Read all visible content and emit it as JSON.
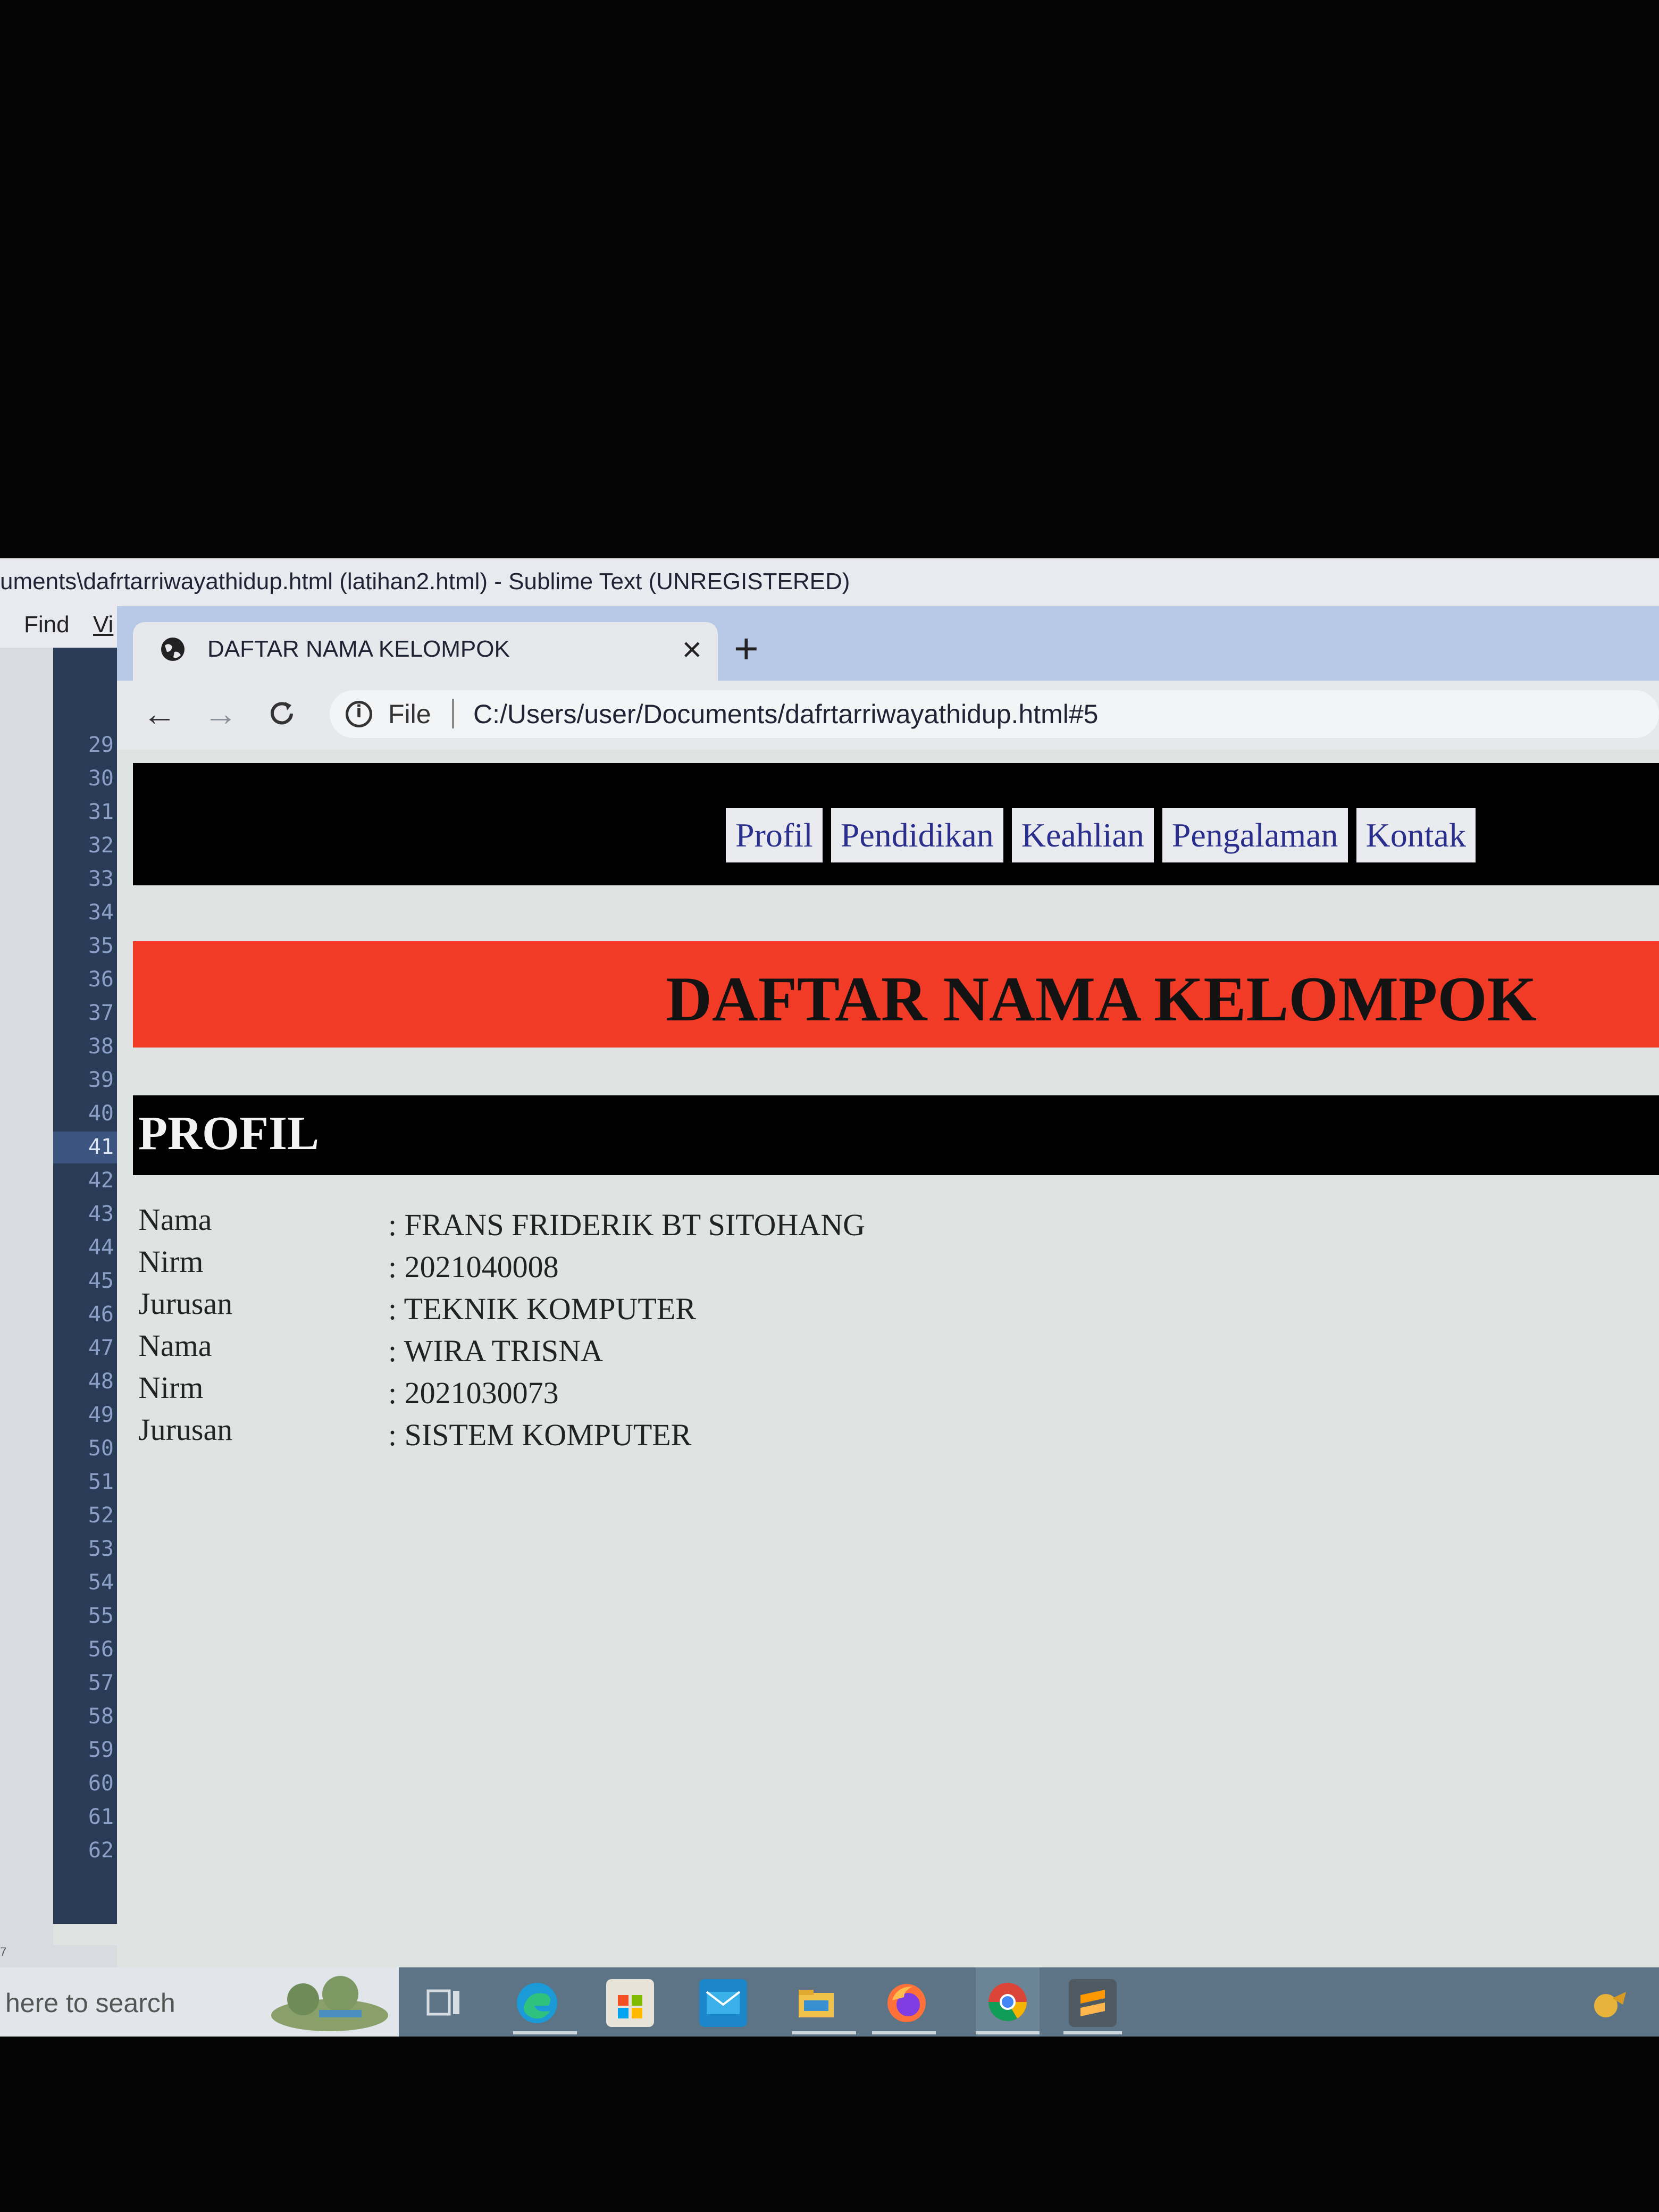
{
  "sublime": {
    "title": "uments\\dafrtarriwayathidup.html (latihan2.html) - Sublime Text (UNREGISTERED)",
    "menu": [
      "Find",
      "Vi"
    ],
    "line_numbers": [
      "29",
      "30",
      "31",
      "32",
      "33",
      "34",
      "35",
      "36",
      "37",
      "38",
      "39",
      "40",
      "41",
      "42",
      "43",
      "44",
      "45",
      "46",
      "47",
      "48",
      "49",
      "50",
      "51",
      "52",
      "53",
      "54",
      "55",
      "56",
      "57",
      "58",
      "59",
      "60",
      "61",
      "62"
    ],
    "active_line": "41",
    "status_fragment": "7"
  },
  "browser": {
    "tab_title": "DAFTAR NAMA KELOMPOK",
    "tab_close": "×",
    "new_tab": "+",
    "nav": {
      "back": "←",
      "forward": "→",
      "reload": "C"
    },
    "file_label": "File",
    "url": "C:/Users/user/Documents/dafrtarriwayathidup.html#5"
  },
  "page": {
    "nav_links": [
      "Profil",
      "Pendidikan",
      "Keahlian",
      "Pengalaman",
      "Kontak"
    ],
    "banner_title": "DAFTAR NAMA KELOMPOK",
    "section_title": "PROFIL",
    "profile_rows": [
      {
        "label": "Nama",
        "value": ": FRANS FRIDERIK BT SITOHANG"
      },
      {
        "label": "Nirm",
        "value": ": 2021040008"
      },
      {
        "label": "Jurusan",
        "value": ": TEKNIK KOMPUTER"
      },
      {
        "label": "Nama",
        "value": ": WIRA TRISNA"
      },
      {
        "label": "Nirm",
        "value": ": 2021030073"
      },
      {
        "label": "Jurusan",
        "value": ": SISTEM KOMPUTER"
      }
    ]
  },
  "taskbar": {
    "search_placeholder": "here to search",
    "icons": [
      "task-view-icon",
      "edge-icon",
      "store-icon",
      "mail-icon",
      "file-explorer-icon",
      "firefox-icon",
      "chrome-icon",
      "sublime-icon"
    ]
  },
  "colors": {
    "banner_red": "#f23b26",
    "nav_link_text": "#2a2e8c",
    "tabstrip": "#b7c8e6",
    "gutter": "#2a3b57"
  }
}
